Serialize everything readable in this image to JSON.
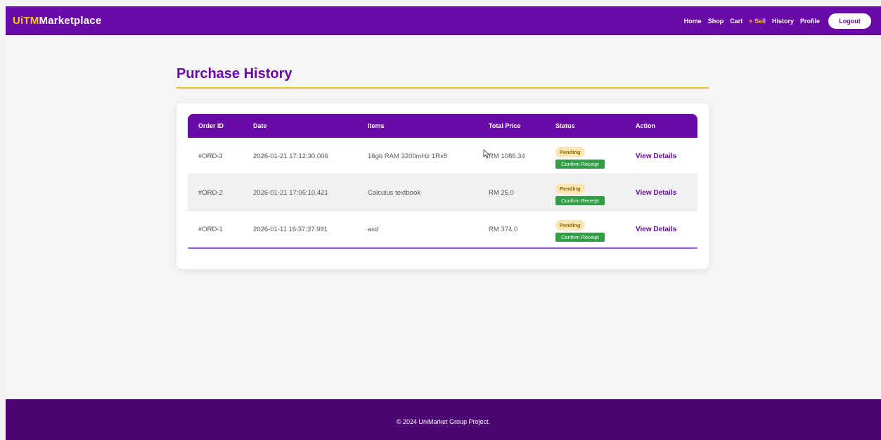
{
  "header": {
    "brand_prefix": "UiTM",
    "brand_suffix": "Marketplace",
    "nav": {
      "home": "Home",
      "shop": "Shop",
      "cart": "Cart",
      "sell": "+ Sell",
      "history": "History",
      "profile": "Profile",
      "logout": "Logout"
    }
  },
  "page": {
    "title": "Purchase History"
  },
  "table": {
    "columns": [
      "Order ID",
      "Date",
      "Items",
      "Total Price",
      "Status",
      "Action"
    ],
    "rows": [
      {
        "order_id": "#ORD-3",
        "date": "2026-01-21 17:12:30.006",
        "items": "16gb RAM 3200mHz 1Rx8",
        "total": "RM 1086.34",
        "status": "Pending",
        "confirm": "Confirm Receipt",
        "action": "View Details"
      },
      {
        "order_id": "#ORD-2",
        "date": "2026-01-21 17:05:10.421",
        "items": "Calculus textbook",
        "total": "RM 25.0",
        "status": "Pending",
        "confirm": "Confirm Receipt",
        "action": "View Details"
      },
      {
        "order_id": "#ORD-1",
        "date": "2026-01-11 16:37:37.991",
        "items": "asd",
        "total": "RM 374.0",
        "status": "Pending",
        "confirm": "Confirm Receipt",
        "action": "View Details"
      }
    ]
  },
  "footer": {
    "text": "© 2024 UniMarket Group Project."
  },
  "colors": {
    "primary": "#6a0aa6",
    "accent": "#f5c518",
    "success": "#2f9e44",
    "pending_bg": "#fce7b4",
    "footer": "#4d0573"
  }
}
